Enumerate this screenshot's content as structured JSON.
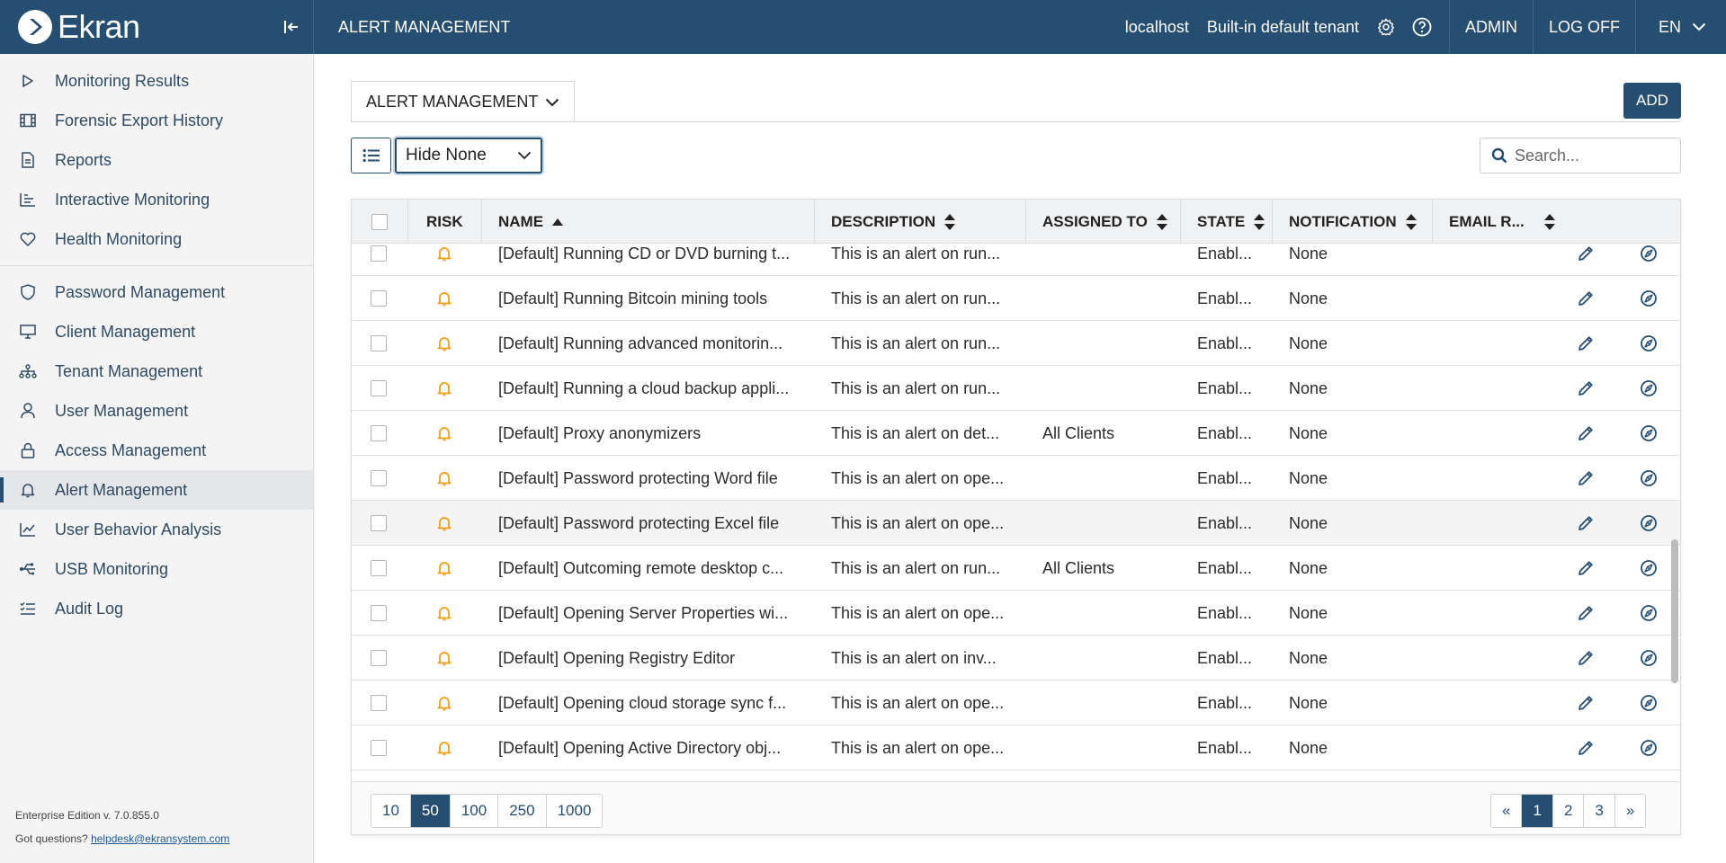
{
  "topbar": {
    "logo": "Ekran",
    "page_title": "ALERT MANAGEMENT",
    "server": "localhost",
    "tenant": "Built-in default tenant",
    "user": "ADMIN",
    "logoff": "LOG OFF",
    "lang": "EN"
  },
  "sidebar": {
    "items": [
      {
        "label": "Monitoring Results",
        "icon": "play-icon"
      },
      {
        "label": "Forensic Export History",
        "icon": "film-icon"
      },
      {
        "label": "Reports",
        "icon": "document-icon"
      },
      {
        "label": "Interactive Monitoring",
        "icon": "bar-chart-icon"
      },
      {
        "label": "Health Monitoring",
        "icon": "heart-icon"
      },
      {
        "label": "Password Management",
        "icon": "shield-icon"
      },
      {
        "label": "Client Management",
        "icon": "monitor-icon"
      },
      {
        "label": "Tenant Management",
        "icon": "hierarchy-icon"
      },
      {
        "label": "User Management",
        "icon": "user-icon"
      },
      {
        "label": "Access Management",
        "icon": "lock-icon"
      },
      {
        "label": "Alert Management",
        "icon": "bell-icon"
      },
      {
        "label": "User Behavior Analysis",
        "icon": "trend-icon"
      },
      {
        "label": "USB Monitoring",
        "icon": "usb-icon"
      },
      {
        "label": "Audit Log",
        "icon": "checklist-icon"
      }
    ],
    "active_label": "Alert Management",
    "footer": {
      "edition": "Enterprise Edition v. 7.0.855.0",
      "questions": "Got questions?",
      "email": "helpdesk@ekransystem.com"
    }
  },
  "main": {
    "tab_label": "ALERT MANAGEMENT",
    "add_label": "ADD",
    "filter_value": "Hide None",
    "search_placeholder": "Search...",
    "columns": {
      "risk": "RISK",
      "name": "NAME",
      "description": "DESCRIPTION",
      "assigned": "ASSIGNED TO",
      "state": "STATE",
      "notification": "NOTIFICATION",
      "email": "EMAIL R..."
    },
    "rows": [
      {
        "name": "[Default] Running CD or DVD burning t...",
        "description": "This is an alert on run...",
        "assigned": "",
        "state": "Enabl...",
        "notification": "None"
      },
      {
        "name": "[Default] Running Bitcoin mining tools",
        "description": "This is an alert on run...",
        "assigned": "",
        "state": "Enabl...",
        "notification": "None"
      },
      {
        "name": "[Default] Running advanced monitorin...",
        "description": "This is an alert on run...",
        "assigned": "",
        "state": "Enabl...",
        "notification": "None"
      },
      {
        "name": "[Default] Running a cloud backup appli...",
        "description": "This is an alert on run...",
        "assigned": "",
        "state": "Enabl...",
        "notification": "None"
      },
      {
        "name": "[Default] Proxy anonymizers",
        "description": "This is an alert on det...",
        "assigned": "All Clients",
        "state": "Enabl...",
        "notification": "None"
      },
      {
        "name": "[Default] Password protecting Word file",
        "description": "This is an alert on ope...",
        "assigned": "",
        "state": "Enabl...",
        "notification": "None"
      },
      {
        "name": "[Default] Password protecting Excel file",
        "description": "This is an alert on ope...",
        "assigned": "",
        "state": "Enabl...",
        "notification": "None"
      },
      {
        "name": "[Default] Outcoming remote desktop c...",
        "description": "This is an alert on run...",
        "assigned": "All Clients",
        "state": "Enabl...",
        "notification": "None"
      },
      {
        "name": "[Default] Opening Server Properties wi...",
        "description": "This is an alert on ope...",
        "assigned": "",
        "state": "Enabl...",
        "notification": "None"
      },
      {
        "name": "[Default] Opening Registry Editor",
        "description": "This is an alert on inv...",
        "assigned": "",
        "state": "Enabl...",
        "notification": "None"
      },
      {
        "name": "[Default] Opening cloud storage sync f...",
        "description": "This is an alert on ope...",
        "assigned": "",
        "state": "Enabl...",
        "notification": "None"
      },
      {
        "name": "[Default] Opening Active Directory obj...",
        "description": "This is an alert on ope...",
        "assigned": "",
        "state": "Enabl...",
        "notification": "None"
      }
    ],
    "highlighted_row": 6,
    "page_sizes": [
      "10",
      "50",
      "100",
      "250",
      "1000"
    ],
    "page_size_selected": "50",
    "pages": [
      "«",
      "1",
      "2",
      "3",
      "»"
    ],
    "page_selected": "1"
  },
  "colors": {
    "brand": "#264e71",
    "bell": "#f39c12"
  }
}
